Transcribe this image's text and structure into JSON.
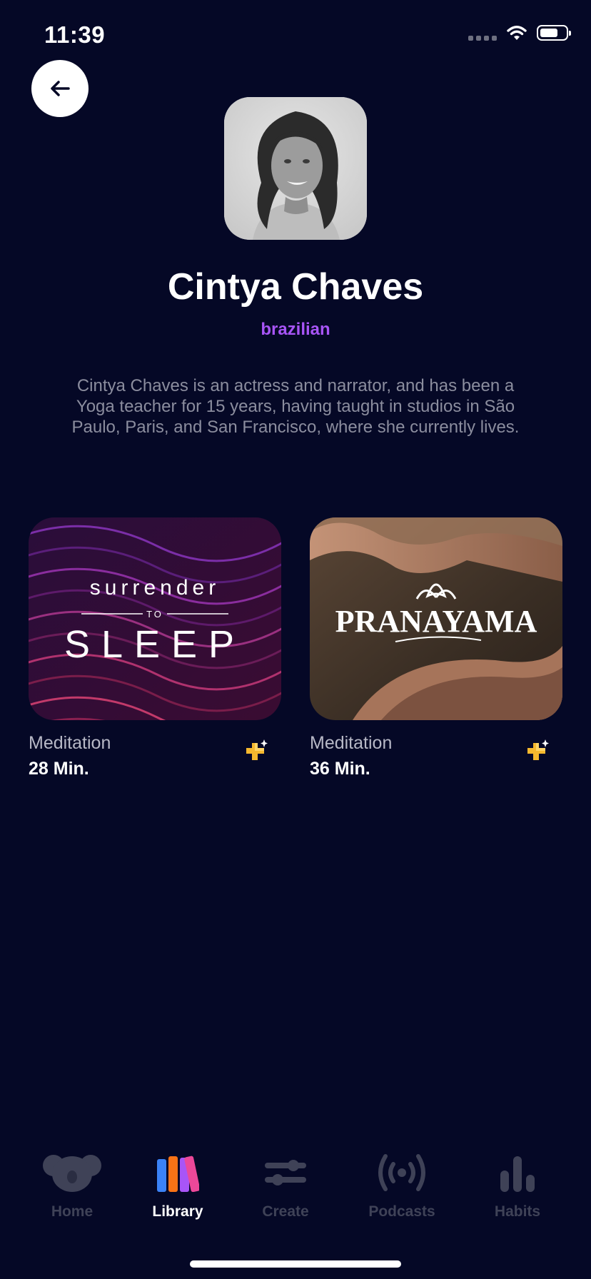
{
  "status_bar": {
    "time": "11:39"
  },
  "back_button": {
    "icon": "arrow-left-icon"
  },
  "profile": {
    "name": "Cintya Chaves",
    "nationality": "brazilian",
    "bio": "Cintya Chaves is an actress and narrator, and has been a Yoga teacher for 15 years, having taught in studios in São Paulo, Paris, and San Francisco, where she currently lives."
  },
  "sessions": [
    {
      "image_title_small": "surrender",
      "image_title_connector": "TO",
      "image_title_large": "SLEEP",
      "category": "Meditation",
      "duration": "28 Min.",
      "badge_icon": "plus-sparkle-icon"
    },
    {
      "image_title": "PRANAYAMA",
      "category": "Meditation",
      "duration": "36 Min.",
      "badge_icon": "plus-sparkle-icon"
    }
  ],
  "tab_bar": {
    "tabs": [
      {
        "label": "Home",
        "icon": "koala-icon",
        "active": false
      },
      {
        "label": "Library",
        "icon": "library-books-icon",
        "active": true
      },
      {
        "label": "Create",
        "icon": "sliders-icon",
        "active": false
      },
      {
        "label": "Podcasts",
        "icon": "broadcast-icon",
        "active": false
      },
      {
        "label": "Habits",
        "icon": "bar-chart-icon",
        "active": false
      }
    ]
  },
  "colors": {
    "background": "#050826",
    "accent": "#a855f7",
    "inactive_tab": "#3f4257",
    "badge": "#f5b82e"
  }
}
